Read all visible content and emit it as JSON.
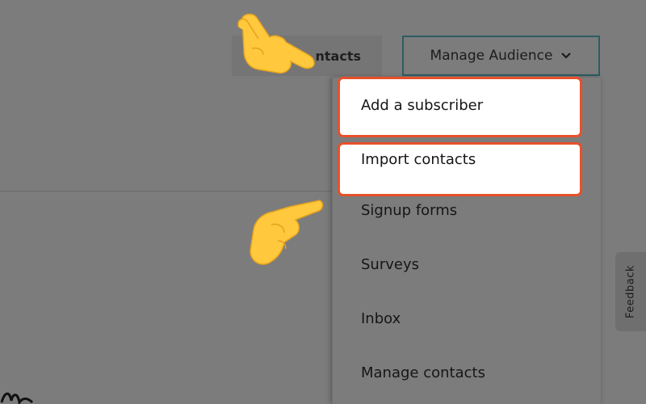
{
  "header": {
    "contacts_label": "ntacts",
    "manage_audience_label": "Manage Audience"
  },
  "menu": {
    "items": [
      {
        "label": "Add a subscriber",
        "highlighted": true
      },
      {
        "label": "Import contacts",
        "highlighted": true
      },
      {
        "label": "Signup forms"
      },
      {
        "label": "Surveys"
      },
      {
        "label": "Inbox"
      },
      {
        "label": "Manage contacts"
      }
    ]
  },
  "feedback": {
    "label": "Feedback"
  },
  "colors": {
    "highlight_border": "#e8502a",
    "manage_button_border": "#2a5e63",
    "hand": "#ffc83d"
  },
  "icons": [
    "chevron-down-icon",
    "pointing-hand-icon"
  ]
}
